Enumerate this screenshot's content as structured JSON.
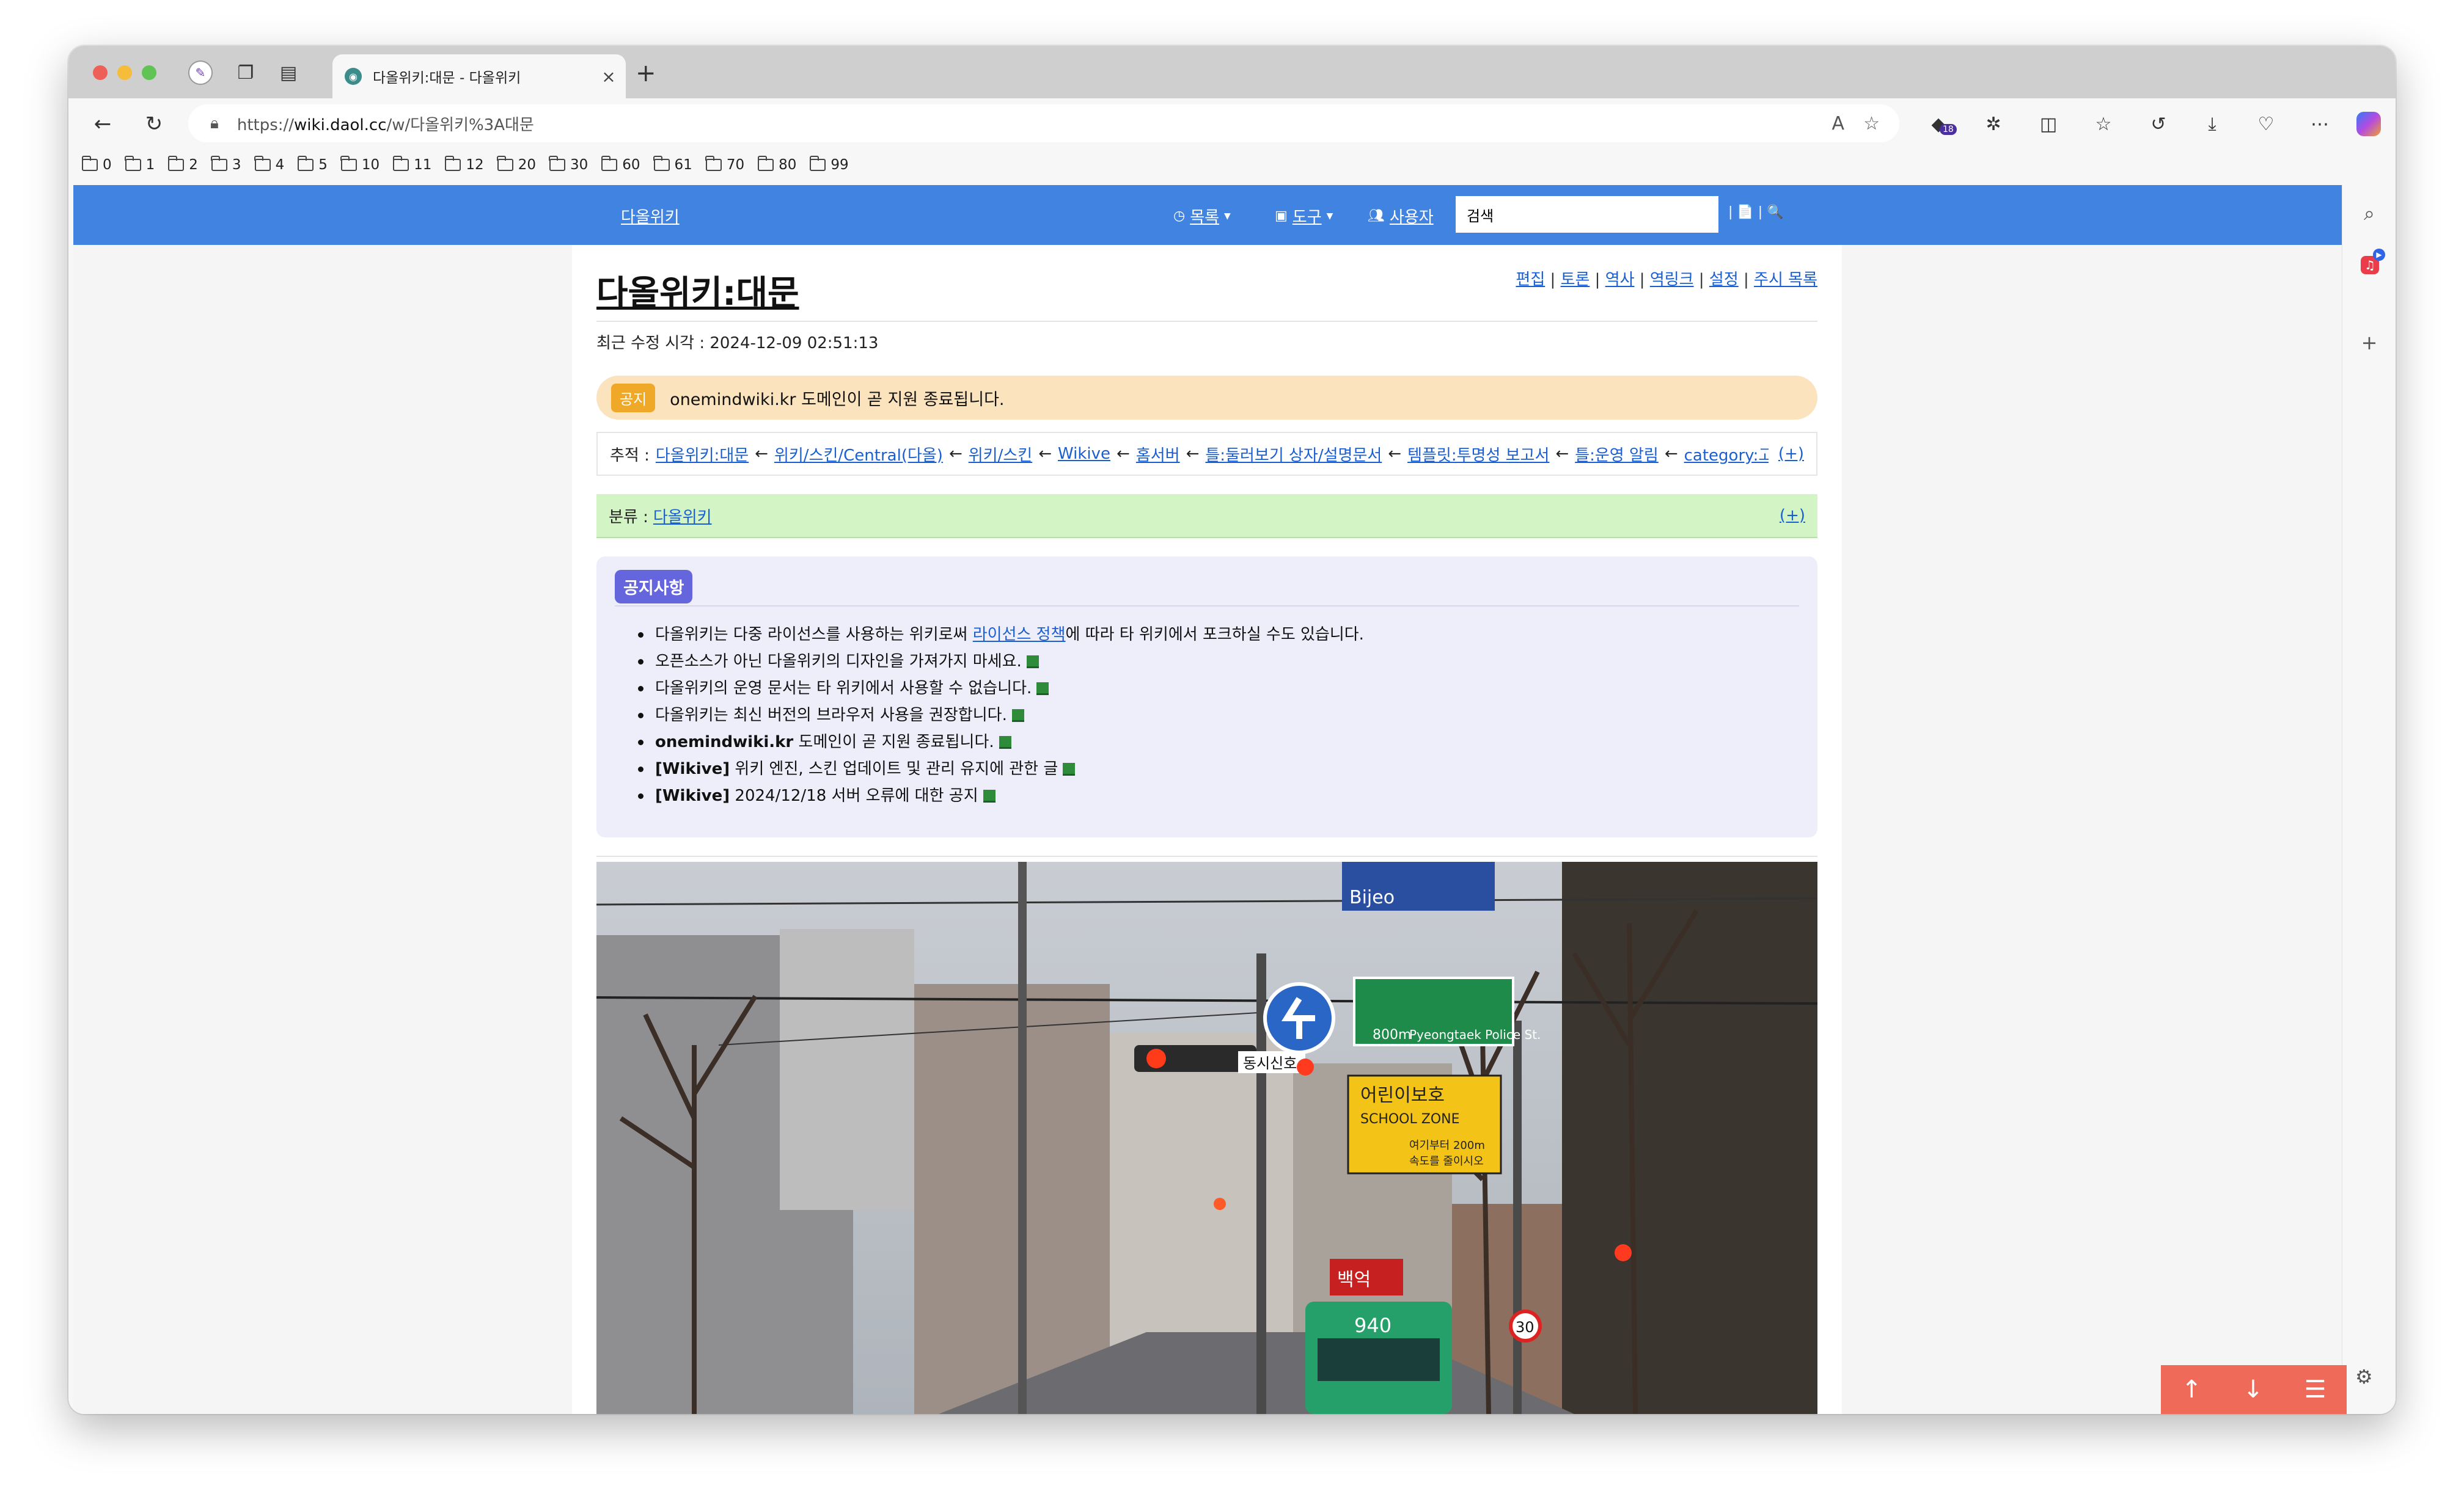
{
  "browser": {
    "tab_title": "다올위키:대문 - 다올위키",
    "url_prefix": "https://",
    "url_host": "wiki.daol.cc",
    "url_path": "/w/다올위키%3A대문",
    "extension_badge": "18",
    "bookmarks": [
      "0",
      "1",
      "2",
      "3",
      "4",
      "5",
      "10",
      "11",
      "12",
      "20",
      "30",
      "60",
      "61",
      "70",
      "80",
      "99"
    ]
  },
  "wiki": {
    "site_name": "다올위키",
    "nav": {
      "list_label": "목록",
      "tools_label": "도구",
      "user_label": "사용자",
      "search_value": "검색",
      "search_tools": "| 📄 | 🔍"
    },
    "article": {
      "title": "다올위키:대문",
      "actions": [
        "편집",
        "토론",
        "역사",
        "역링크",
        "설정",
        "주시 목록"
      ],
      "last_modified": "최근 수정 시각 : 2024-12-09 02:51:13",
      "notice_tag": "공지",
      "notice_text": "onemindwiki.kr 도메인이 곧 지원 종료됩니다.",
      "trail_label": "추적 :",
      "trail": [
        "다올위키:대문",
        "위키/스킨/Central(다올)",
        "위키/스킨",
        "Wikive",
        "홈서버",
        "틀:둘러보기 상자/설명문서",
        "템플릿:투명성 보고서",
        "틀:운영 알림",
        "category:고..."
      ],
      "trail_more": "(+)",
      "category_label": "분류 :",
      "category_link": "다올위키",
      "category_more": "(+)",
      "announce_tag": "공지사항",
      "announce": [
        {
          "pre": "다올위키는 다중 라이선스를 사용하는 위키로써 ",
          "link": "라이선스 정책",
          "post": "에 따라 타 위키에서 포크하실 수도 있습니다."
        },
        {
          "text": "오픈소스가 아닌 다올위키의 디자인을 가져가지 마세요."
        },
        {
          "text": "다올위키의 운영 문서는 타 위키에서 사용할 수 없습니다."
        },
        {
          "text": "다올위키는 최신 버전의 브라우저 사용을 권장합니다."
        },
        {
          "bold": "onemindwiki.kr",
          "text": " 도메인이 곧 지원 종료됩니다."
        },
        {
          "bold": "[Wikive]",
          "text": " 위키 엔진, 스킨 업데이트 및 관리 유지에 관한 글"
        },
        {
          "bold": "[Wikive]",
          "text": " 2024/12/18 서버 오류에 대한 공지"
        }
      ]
    }
  },
  "photo": {
    "signs": [
      "동시신호",
      "800m",
      "Pyeongtaek Police St.",
      "어린이보호",
      "SCHOOL ZONE",
      "여기부터 200m",
      "속도를 줄이시오",
      "30",
      "940",
      "백억",
      "Bijeo"
    ]
  },
  "colors": {
    "wiki_nav": "#4183e0",
    "notice_bg": "#fae3bd",
    "category_bg": "#d3f5c5",
    "announce_bg": "#eeeefa",
    "float_buttons": "#f06a5a"
  },
  "icons": {
    "nav": [
      "back-icon",
      "reload-icon",
      "lock-icon"
    ],
    "floating": [
      "arrow-up-icon",
      "arrow-down-icon",
      "list-icon"
    ]
  }
}
